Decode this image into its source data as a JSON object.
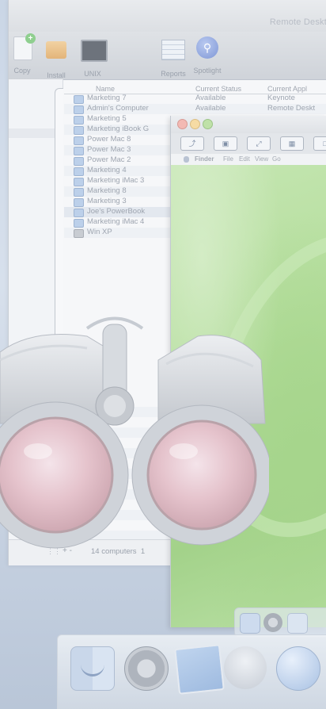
{
  "window": {
    "title": "Remote Deskt"
  },
  "toolbar": {
    "copy": "Copy",
    "install": "Install",
    "unix": "UNIX",
    "reports": "Reports",
    "spotlight": "Spotlight"
  },
  "table": {
    "headers": {
      "name": "Name",
      "status": "Current Status",
      "app": "Current Appl"
    },
    "rows": [
      {
        "name": "Marketing 7",
        "status": "Available",
        "app": "Keynote"
      },
      {
        "name": "Admin's Computer",
        "status": "Available",
        "app": "Remote Deskt"
      },
      {
        "name": "Marketing 5",
        "status": "",
        "app": ""
      },
      {
        "name": "Marketing iBook G",
        "status": "",
        "app": ""
      },
      {
        "name": "Power Mac 8",
        "status": "",
        "app": ""
      },
      {
        "name": "Power Mac 3",
        "status": "",
        "app": ""
      },
      {
        "name": "Power Mac 2",
        "status": "",
        "app": ""
      },
      {
        "name": "Marketing 4",
        "status": "",
        "app": ""
      },
      {
        "name": "Marketing iMac 3",
        "status": "",
        "app": ""
      },
      {
        "name": "Marketing 8",
        "status": "",
        "app": ""
      },
      {
        "name": "Marketing 3",
        "status": "",
        "app": ""
      },
      {
        "name": "Joe's PowerBook",
        "status": "",
        "app": ""
      },
      {
        "name": "Marketing iMac 4",
        "status": "",
        "app": ""
      },
      {
        "name": "Win XP",
        "status": "",
        "app": ""
      }
    ]
  },
  "status_bar": {
    "add_remove": "+ -",
    "count": "14 computers",
    "extra": "1"
  },
  "remote_menu": {
    "finder": "Finder",
    "file": "File",
    "edit": "Edit",
    "view": "View",
    "go": "Go"
  }
}
